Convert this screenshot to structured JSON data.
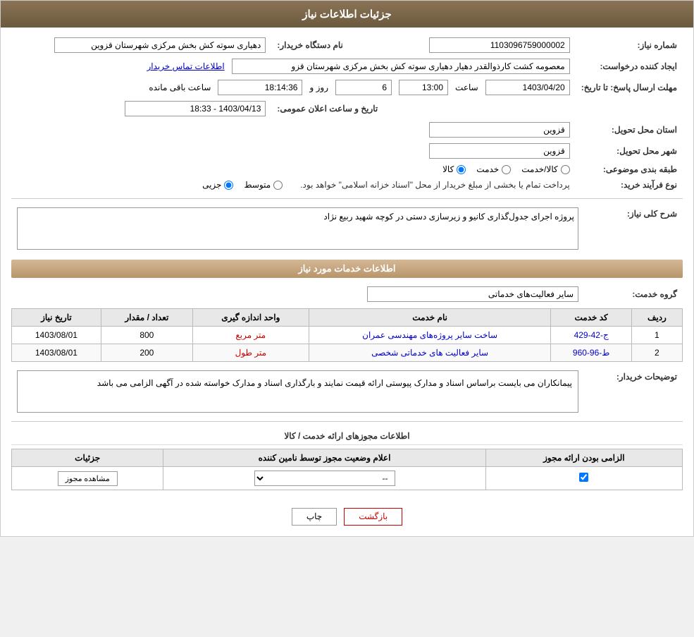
{
  "header": {
    "title": "جزئیات اطلاعات نیاز"
  },
  "main_info": {
    "need_number_label": "شماره نیاز:",
    "need_number_value": "1103096759000002",
    "buyer_org_label": "نام دستگاه خریدار:",
    "buyer_org_value": "دهیاری سوته کش بخش مرکزی شهرستان قزوین",
    "creator_label": "ایجاد کننده درخواست:",
    "creator_value": "معصومه کشت کارذوالقدر دهیار دهیاری سوته کش بخش مرکزی شهرستان قزو",
    "contact_link": "اطلاعات تماس خریدار",
    "deadline_label": "مهلت ارسال پاسخ: تا تاریخ:",
    "deadline_date": "1403/04/20",
    "deadline_time": "13:00",
    "deadline_days": "6",
    "deadline_remaining": "18:14:36",
    "deadline_days_label": "روز و",
    "deadline_remaining_label": "ساعت باقی مانده",
    "announcement_label": "تاریخ و ساعت اعلان عمومی:",
    "announcement_value": "1403/04/13 - 18:33",
    "province_label": "استان محل تحویل:",
    "province_value": "قزوین",
    "city_label": "شهر محل تحویل:",
    "city_value": "قزوین",
    "category_label": "طبقه بندی موضوعی:",
    "category_options": [
      "کالا",
      "خدمت",
      "کالا/خدمت"
    ],
    "category_selected": "کالا",
    "process_label": "نوع فرآیند خرید:",
    "process_options": [
      "جزیی",
      "متوسط"
    ],
    "process_note": "پرداخت تمام یا بخشی از مبلغ خریدار از محل \"اسناد خزانه اسلامی\" خواهد بود.",
    "description_label": "شرح کلی نیاز:",
    "description_value": "پروژه اجرای جدول‌گذاری کانیو و زیرسازی دستی در کوچه شهید ربیع نژاد"
  },
  "services_section": {
    "title": "اطلاعات خدمات مورد نیاز",
    "service_group_label": "گروه خدمت:",
    "service_group_value": "سایر فعالیت‌های خدماتی",
    "table_headers": {
      "row_num": "ردیف",
      "service_code": "کد خدمت",
      "service_name": "نام خدمت",
      "unit": "واحد اندازه گیری",
      "quantity": "تعداد / مقدار",
      "date": "تاریخ نیاز"
    },
    "rows": [
      {
        "num": "1",
        "code": "ج-42-429",
        "name": "ساخت سایر پروژه‌های مهندسی عمران",
        "unit": "متر مربع",
        "quantity": "800",
        "date": "1403/08/01"
      },
      {
        "num": "2",
        "code": "ط-96-960",
        "name": "سایر فعالیت های خدماتی شخصی",
        "unit": "متر طول",
        "quantity": "200",
        "date": "1403/08/01"
      }
    ]
  },
  "buyer_notes_label": "توضیحات خریدار:",
  "buyer_notes_value": "پیمانکاران می بایست براساس اسناد و مدارک پیوستی ارائه قیمت نمایند و بارگذاری اسناد و مدارک خواسته شده در آگهی الزامی می باشد",
  "license_section": {
    "sub_title": "اطلاعات مجوزهای ارائه خدمت / کالا",
    "table_headers": {
      "required": "الزامی بودن ارائه مجوز",
      "status_label": "اعلام وضعیت مجوز توسط نامین کننده",
      "details": "جزئیات"
    },
    "rows": [
      {
        "required": true,
        "status": "--",
        "view_button": "مشاهده مجوز"
      }
    ]
  },
  "buttons": {
    "print": "چاپ",
    "back": "بازگشت"
  }
}
